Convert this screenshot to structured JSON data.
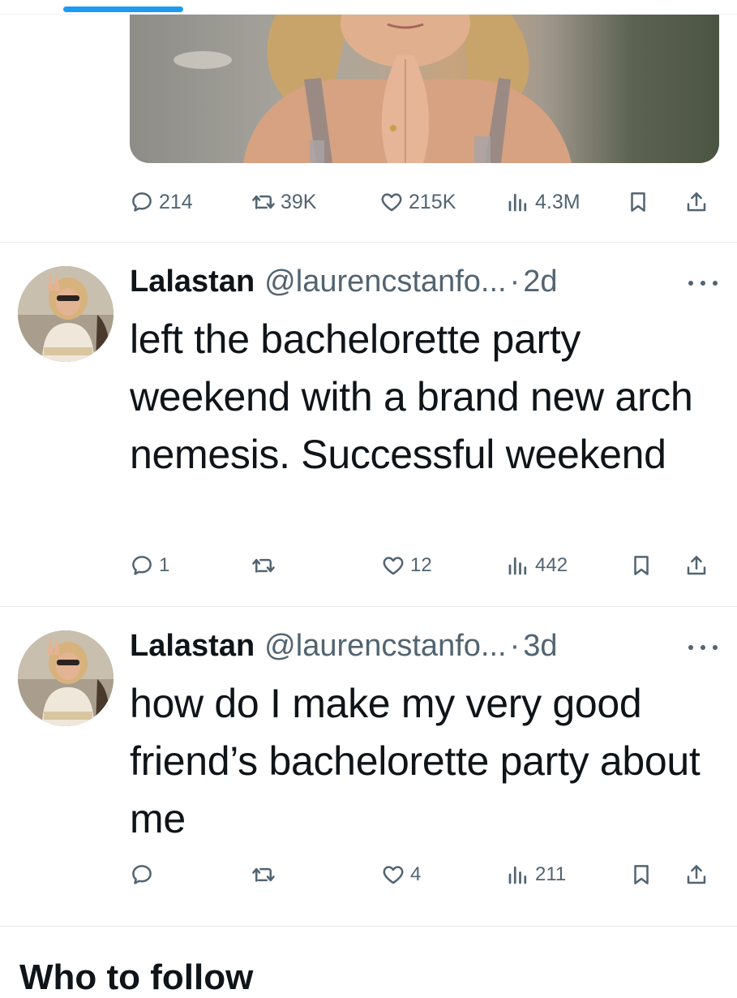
{
  "previous_tweet": {
    "actions": {
      "replies": "214",
      "retweets": "39K",
      "likes": "215K",
      "views": "4.3M"
    }
  },
  "tweets": [
    {
      "name": "Lalastan",
      "handle": "@laurencstanfo...",
      "separator": "·",
      "time": "2d",
      "text": "left the bachelorette party weekend with a brand new arch nemesis. Successful weekend",
      "actions": {
        "replies": "1",
        "retweets": "",
        "likes": "12",
        "views": "442"
      }
    },
    {
      "name": "Lalastan",
      "handle": "@laurencstanfo...",
      "separator": "·",
      "time": "3d",
      "text": "how do I make my very good friend’s bachelorette party about me",
      "actions": {
        "replies": "",
        "retweets": "",
        "likes": "4",
        "views": "211"
      }
    }
  ],
  "next_section": {
    "title": "Who to follow"
  },
  "colors": {
    "accent": "#1d9bf0",
    "text": "#0f1419",
    "secondary": "#536471",
    "divider": "#e6eaec"
  },
  "icons": [
    "reply-icon",
    "retweet-icon",
    "like-icon",
    "views-icon",
    "bookmark-icon",
    "share-icon",
    "more-icon"
  ]
}
